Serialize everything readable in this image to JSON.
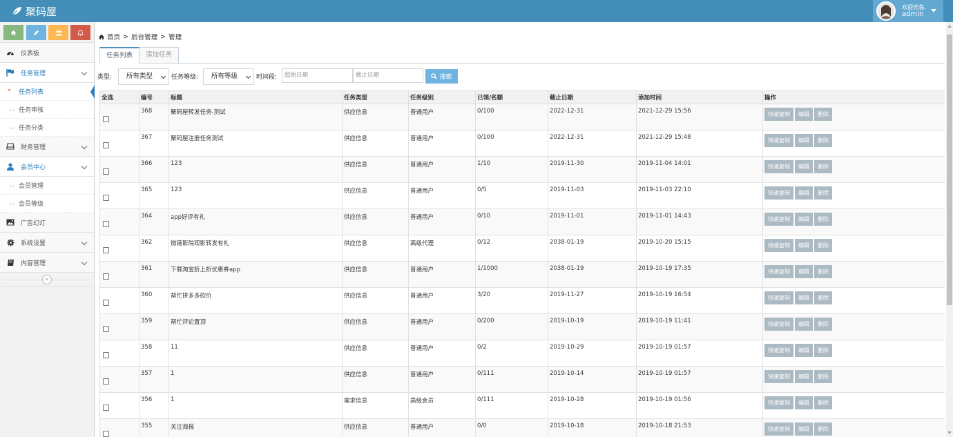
{
  "app": {
    "brand": "聚码屋",
    "user": {
      "greeting": "欢迎光临,",
      "name": "admin"
    }
  },
  "colors": {
    "navbar": "#438eb9",
    "accent": "#2b7dbc",
    "shortcut_green": "#87b87f",
    "shortcut_blue": "#6fb3e0",
    "shortcut_orange": "#ffb752",
    "shortcut_red": "#d15b47",
    "button_gray": "#abbac3"
  },
  "shortcuts": [
    {
      "icon": "home-icon"
    },
    {
      "icon": "pencil-icon"
    },
    {
      "icon": "users-icon"
    },
    {
      "icon": "bell-icon"
    }
  ],
  "sidebar": {
    "items": [
      {
        "label": "仪表板",
        "icon": "dashboard-icon"
      },
      {
        "label": "任务管理",
        "icon": "flag-icon",
        "children": [
          "任务列表",
          "任务审核",
          "任务分类"
        ]
      },
      {
        "label": "财务管理",
        "icon": "drive-icon"
      },
      {
        "label": "会员中心",
        "icon": "user-icon",
        "children": [
          "会员管理",
          "会员等级"
        ]
      },
      {
        "label": "广告幻灯",
        "icon": "picture-icon"
      },
      {
        "label": "系统设置",
        "icon": "cog-icon"
      },
      {
        "label": "内容管理",
        "icon": "book-icon"
      }
    ],
    "collapse_glyph": "«"
  },
  "breadcrumb": {
    "home": "首页",
    "sep": ">",
    "level2": "后台管理",
    "level3": "管理"
  },
  "tabs": [
    "任务列表",
    "添加任务"
  ],
  "filter": {
    "type_label": "类型:",
    "type_value": "所有类型",
    "level_label": "任务等级:",
    "level_value": "所有等级",
    "period_label": "时间段:",
    "start_placeholder": "起始日期",
    "end_placeholder": "截止日期",
    "search_label": "搜索"
  },
  "table": {
    "headers": [
      "全选",
      "编号",
      "标题",
      "任务类型",
      "任务级别",
      "已领/名额",
      "截止日期",
      "添加时间",
      "操作"
    ],
    "actions": [
      "快速复制",
      "编辑",
      "删除"
    ],
    "rows": [
      [
        "368",
        "聚码屋转发任务-测试",
        "供应信息",
        "普通用户",
        "0/100",
        "2022-12-31",
        "2021-12-29 15:56"
      ],
      [
        "367",
        "聚码屋注册任务测试",
        "供应信息",
        "普通用户",
        "0/100",
        "2022-12-31",
        "2021-12-29 15:48"
      ],
      [
        "366",
        "123",
        "供应信息",
        "普通用户",
        "1/10",
        "2019-11-30",
        "2019-11-04 14:01"
      ],
      [
        "365",
        "123",
        "供应信息",
        "普通用户",
        "0/5",
        "2019-11-03",
        "2019-11-03 22:10"
      ],
      [
        "364",
        "app好评有礼",
        "供应信息",
        "普通用户",
        "0/10",
        "2019-11-01",
        "2019-11-01 14:43"
      ],
      [
        "362",
        "微链影院观影转发有礼",
        "供应信息",
        "高级代理",
        "0/12",
        "2038-01-19",
        "2019-10-20 15:15"
      ],
      [
        "361",
        "下载淘宝折上折优惠券app",
        "供应信息",
        "普通用户",
        "1/1000",
        "2038-01-19",
        "2019-10-19 17:35"
      ],
      [
        "360",
        "帮忙拼多多砍价",
        "供应信息",
        "普通用户",
        "3/20",
        "2019-11-27",
        "2019-10-19 16:54"
      ],
      [
        "359",
        "帮忙评论置顶",
        "供应信息",
        "普通用户",
        "0/200",
        "2019-10-19",
        "2019-10-19 11:41"
      ],
      [
        "358",
        "11",
        "供应信息",
        "普通用户",
        "0/2",
        "2019-10-29",
        "2019-10-19 01:57"
      ],
      [
        "357",
        "1",
        "供应信息",
        "普通用户",
        "0/111",
        "2019-10-14",
        "2019-10-19 01:57"
      ],
      [
        "356",
        "1",
        "需求信息",
        "高级会员",
        "0/111",
        "2019-10-28",
        "2019-10-19 01:56"
      ],
      [
        "355",
        "关注海报",
        "供应信息",
        "普通用户",
        "0/0",
        "2019-10-18",
        "2019-10-18 21:53"
      ]
    ]
  }
}
